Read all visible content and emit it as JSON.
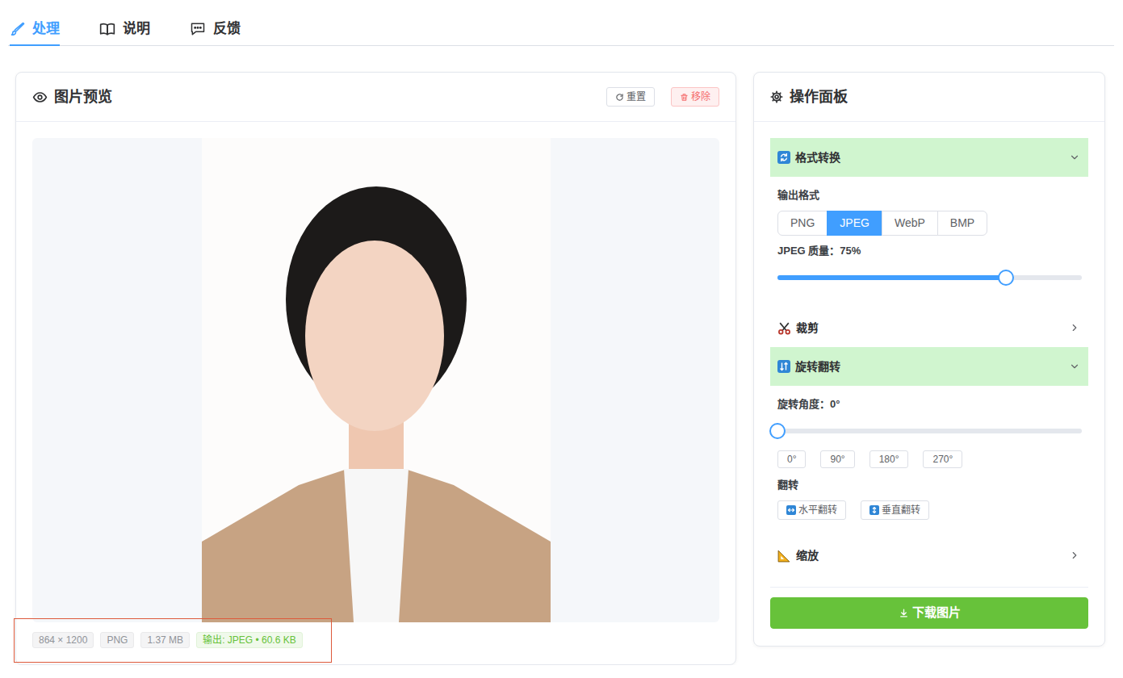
{
  "tabs": [
    {
      "label": "处理",
      "selected": true,
      "kind": "process"
    },
    {
      "label": "说明",
      "selected": false,
      "kind": "docs"
    },
    {
      "label": "反馈",
      "selected": false,
      "kind": "feedback"
    }
  ],
  "preview": {
    "title": "图片预览",
    "actions": [
      {
        "label": "重置",
        "kind": "reset"
      },
      {
        "label": "移除",
        "kind": "remove"
      }
    ],
    "info": [
      {
        "text": "864 × 1200",
        "kind": "meta"
      },
      {
        "text": "PNG",
        "kind": "meta"
      },
      {
        "text": "1.37 MB",
        "kind": "meta"
      },
      {
        "text": "输出: JPEG • 60.6 KB",
        "kind": "output"
      }
    ]
  },
  "panel": {
    "title": "操作面板",
    "sections": [
      {
        "title": "格式转换",
        "kind": "format",
        "expanded": true,
        "format_label": "输出格式",
        "formats": [
          {
            "label": "PNG",
            "selected": false
          },
          {
            "label": "JPEG",
            "selected": true
          },
          {
            "label": "WebP",
            "selected": false
          },
          {
            "label": "BMP",
            "selected": false
          }
        ],
        "quality": {
          "label": "JPEG 质量：75%",
          "level": 0.75
        }
      },
      {
        "title": "裁剪",
        "kind": "crop",
        "expanded": false
      },
      {
        "title": "旋转翻转",
        "kind": "rotate",
        "expanded": true,
        "angle": {
          "label": "旋转角度：0°",
          "level": 0
        },
        "presets": [
          "0°",
          "90°",
          "180°",
          "270°"
        ],
        "flip_label": "翻转",
        "flips": [
          {
            "label": "水平翻转",
            "kind": "horizontal"
          },
          {
            "label": "垂直翻转",
            "kind": "vertical"
          }
        ]
      },
      {
        "title": "缩放",
        "kind": "scale",
        "expanded": false
      }
    ],
    "download": "下载图片"
  }
}
